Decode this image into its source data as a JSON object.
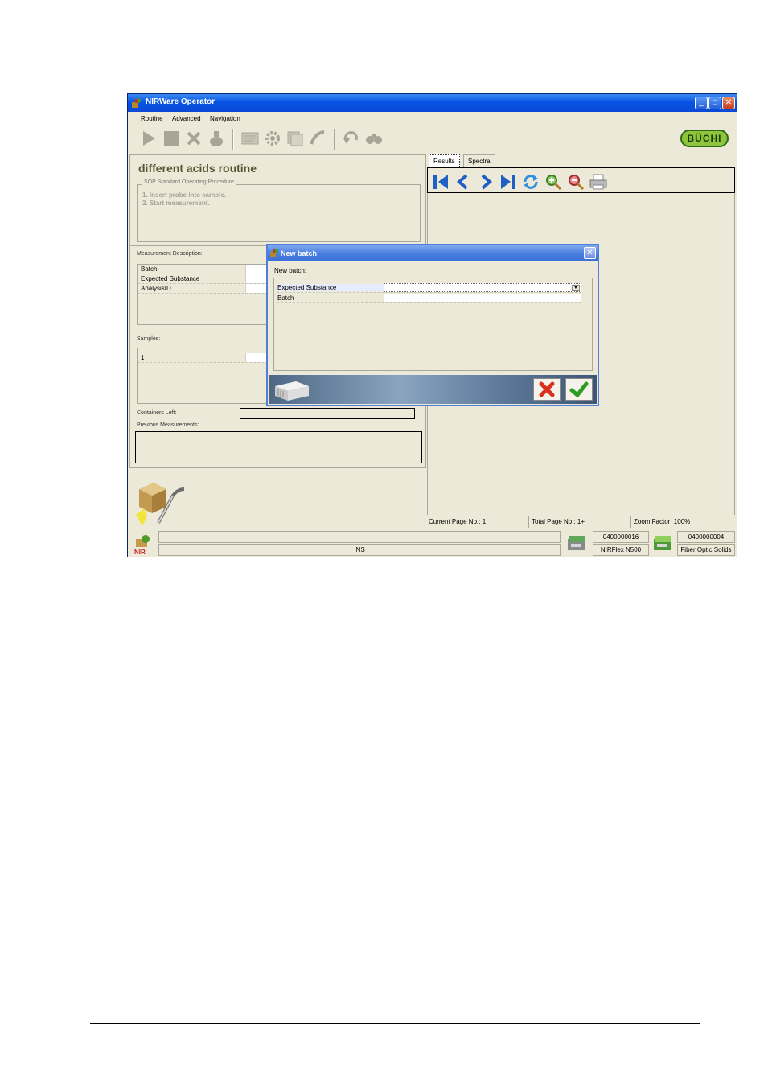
{
  "window": {
    "title": "NIRWare Operator",
    "controls": {
      "minimize": "_",
      "maximize": "□",
      "close": "✕"
    }
  },
  "menu": {
    "items": [
      "Routine",
      "Advanced",
      "Navigation"
    ]
  },
  "brand": {
    "logo": "BÜCHI"
  },
  "routine": {
    "title": "different acids routine",
    "sop_legend": "SOP Standard Operating Procedure",
    "sop_steps": [
      "1. Insert probe into sample.",
      "2. Start measurement."
    ]
  },
  "measurement": {
    "header": "Measurement Description:",
    "rows": [
      {
        "label": "Batch"
      },
      {
        "label": "Expected Substance"
      },
      {
        "label": "AnalysisID"
      }
    ]
  },
  "samples": {
    "header": "Samples:",
    "rows": [
      {
        "label": "1"
      }
    ]
  },
  "containers": {
    "label": "Containers Left:"
  },
  "previous": {
    "label": "Previous Measurements:"
  },
  "tabs": [
    {
      "label": "Results",
      "active": true
    },
    {
      "label": "Spectra",
      "active": false
    }
  ],
  "pagebar": {
    "current": "Current Page No.: 1",
    "total": "Total Page No.: 1+",
    "zoom": "Zoom Factor: 100%"
  },
  "status": {
    "mode": "INS",
    "device1_serial": "0400000016",
    "device1_name": "NIRFlex N500",
    "device2_serial": "0400000004",
    "device2_name": "Fiber Optic Solids"
  },
  "dialog": {
    "title": "New batch",
    "label": "New batch:",
    "rows": [
      {
        "label": "Expected Substance",
        "value": ""
      },
      {
        "label": "Batch",
        "value": ""
      }
    ]
  },
  "colors": {
    "titlebar": "#0754e3",
    "dialog_titlebar": "#4a7fe0",
    "nav_arrows": "#1f5fc6",
    "window_bg": "#ece9d8",
    "logo_green": "#8fc43c"
  }
}
